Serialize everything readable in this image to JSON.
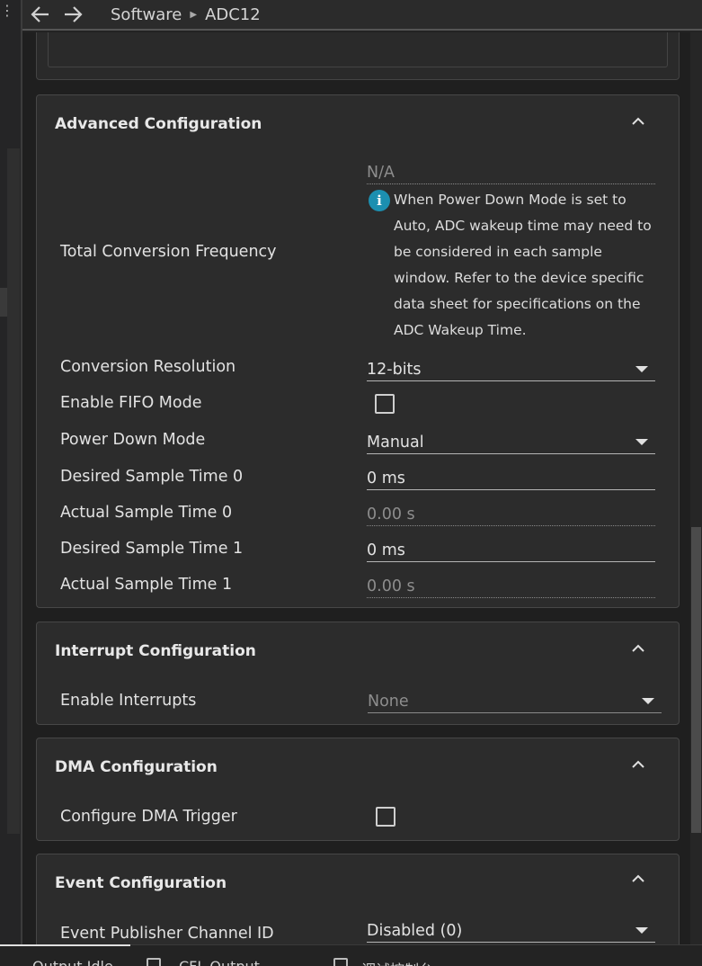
{
  "breadcrumb": {
    "items": [
      "Software",
      "ADC12"
    ]
  },
  "advanced": {
    "title": "Advanced Configuration",
    "total_conversion_frequency": {
      "label": "Total Conversion Frequency",
      "value": "N/A",
      "info": "When Power Down Mode is set to Auto, ADC wakeup time may need to be considered in each sample window. Refer to the device specific data sheet for specifications on the ADC Wakeup Time."
    },
    "conversion_resolution": {
      "label": "Conversion Resolution",
      "value": "12-bits"
    },
    "enable_fifo": {
      "label": "Enable FIFO Mode",
      "checked": false
    },
    "power_down_mode": {
      "label": "Power Down Mode",
      "value": "Manual"
    },
    "desired_sample_time_0": {
      "label": "Desired Sample Time 0",
      "value": "0 ms"
    },
    "actual_sample_time_0": {
      "label": "Actual Sample Time 0",
      "value": "0.00 s"
    },
    "desired_sample_time_1": {
      "label": "Desired Sample Time 1",
      "value": "0 ms"
    },
    "actual_sample_time_1": {
      "label": "Actual Sample Time 1",
      "value": "0.00 s"
    }
  },
  "interrupt": {
    "title": "Interrupt Configuration",
    "enable_interrupts": {
      "label": "Enable Interrupts",
      "value": "None"
    }
  },
  "dma": {
    "title": "DMA Configuration",
    "configure_trigger": {
      "label": "Configure DMA Trigger",
      "checked": false
    }
  },
  "event": {
    "title": "Event Configuration",
    "publisher_channel": {
      "label": "Event Publisher Channel ID",
      "value": "Disabled (0)"
    }
  },
  "bottom_tabs": [
    "Output Idle",
    "CFL Output",
    "调试控制台"
  ],
  "icons": {
    "back": "arrow-left-icon",
    "forward": "arrow-right-icon",
    "breadcrumb_sep": "caret-right-icon",
    "collapse": "chevron-up-icon",
    "dropdown": "caret-down-icon",
    "info": "info-icon"
  },
  "colors": {
    "background": "#1f1f1f",
    "panel": "#2c2c2c",
    "info_accent": "#1c8fb0"
  }
}
